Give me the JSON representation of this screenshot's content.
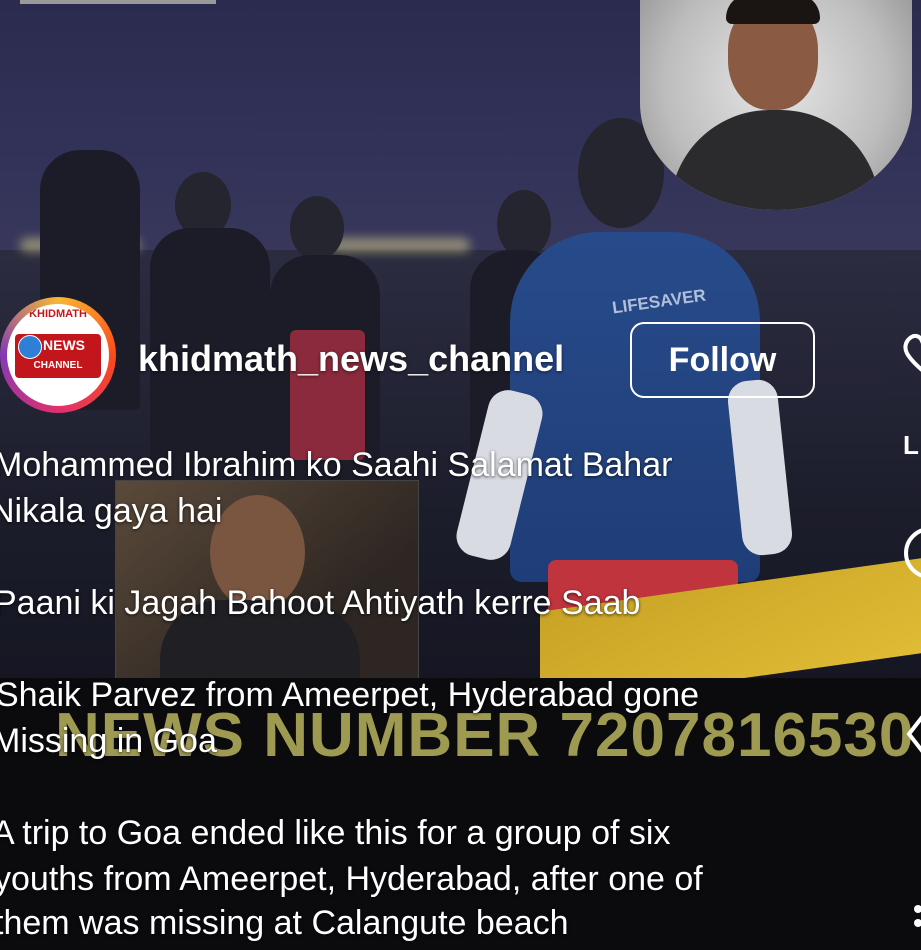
{
  "post": {
    "username": "khidmath_news_channel",
    "follow_label": "Follow",
    "avatar": {
      "logo_top": "KHIDMATH",
      "logo_middle": "NEWS",
      "logo_bottom": "CHANNEL"
    },
    "video": {
      "shirt_text": "LIFESAVER",
      "banner_text": "NEWS NUMBER 7207816530"
    },
    "caption": {
      "line1": "Mohammed Ibrahim ko Saahi Salamat Bahar",
      "line2": "Nikala gaya hai",
      "line3": "Paani ki Jagah Bahoot Ahtiyath kerre Saab",
      "line4": "Shaik Parvez from Ameerpet, Hyderabad gone",
      "line5": "Missing in Goa",
      "line6": "A trip to Goa ended like this for a group of six",
      "line7": "youths from Ameerpet, Hyderabad, after one of",
      "line8": "them was missing at Calangute beach"
    },
    "side_actions": {
      "like_label": "L",
      "like_icon": "heart-icon",
      "comment_icon": "comment-icon",
      "share_icon": "share-icon",
      "more_icon": "more-icon"
    }
  }
}
